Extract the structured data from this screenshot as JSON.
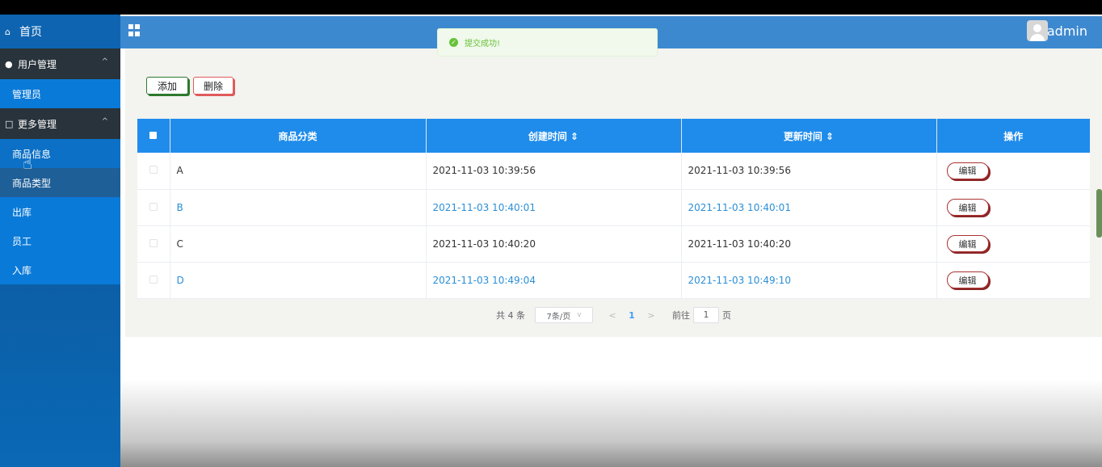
{
  "sidebar": {
    "home": "首页",
    "user_group": "用户管理",
    "user_items": [
      "管理员"
    ],
    "more_group": "更多管理",
    "more_items": [
      "商品信息",
      "商品类型",
      "出库",
      "员工",
      "入库"
    ]
  },
  "header": {
    "user": "admin"
  },
  "toast": {
    "message": "提交成功!"
  },
  "toolbar": {
    "add_label": "添加",
    "delete_label": "删除"
  },
  "table": {
    "columns": [
      "商品分类",
      "创建时间 ⇕",
      "更新时间 ⇕",
      "操作"
    ],
    "rows": [
      {
        "category": "A",
        "created": "2021-11-03 10:39:56",
        "updated": "2021-11-03 10:39:56",
        "action": "编辑"
      },
      {
        "category": "B",
        "created": "2021-11-03 10:40:01",
        "updated": "2021-11-03 10:40:01",
        "action": "编辑"
      },
      {
        "category": "C",
        "created": "2021-11-03 10:40:20",
        "updated": "2021-11-03 10:40:20",
        "action": "编辑"
      },
      {
        "category": "D",
        "created": "2021-11-03 10:49:04",
        "updated": "2021-11-03 10:49:10",
        "action": "编辑"
      }
    ]
  },
  "pagination": {
    "total": "共 4 条",
    "page_size": "7条/页",
    "current_page": "1",
    "goto_prefix": "前往",
    "goto_value": "1",
    "goto_suffix": "页"
  },
  "colors": {
    "header": "#3d89d0",
    "table_header": "#1f8ceb",
    "toast_text": "#67c23a"
  },
  "icons": {
    "home": "home-icon",
    "user": "user-icon",
    "more": "copy-icon",
    "menu": "grid-icon"
  }
}
